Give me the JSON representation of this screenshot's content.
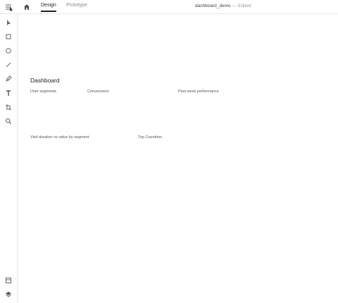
{
  "header": {
    "tabs": [
      {
        "label": "Design",
        "active": true
      },
      {
        "label": "Prototype",
        "active": false
      }
    ],
    "document_name": "dashboard_demo",
    "separator": "—",
    "status": "Edited"
  },
  "toolbar": {
    "tools": [
      "select-tool",
      "rectangle-tool",
      "ellipse-tool",
      "line-tool",
      "pen-tool",
      "text-tool",
      "artboard-tool",
      "zoom-tool"
    ],
    "bottom": [
      "assets-panel",
      "layers-panel"
    ]
  },
  "canvas": {
    "title": "Dashboard",
    "labels": {
      "user_segments": "User segments",
      "conversions": "Conversions",
      "past_week": "Past week performance",
      "visit_duration": "Visit duration vs value by segment",
      "top_countries": "Top Countries"
    }
  }
}
